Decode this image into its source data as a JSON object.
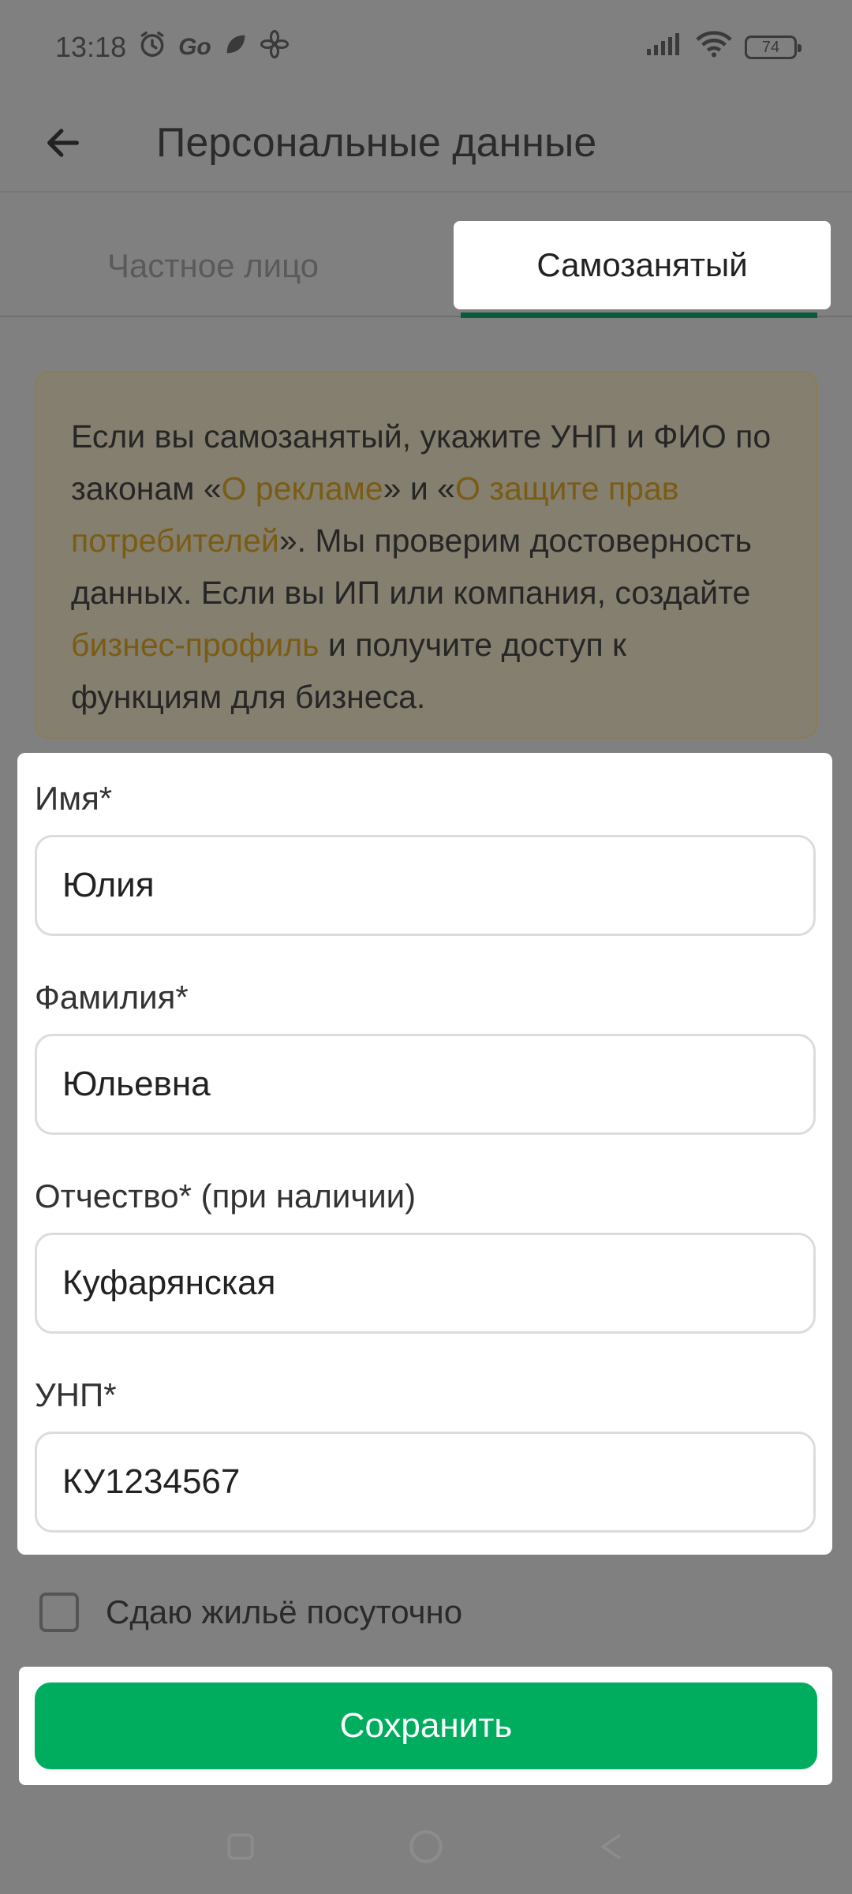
{
  "status_bar": {
    "time": "13:18",
    "battery": "74",
    "icons": [
      "alarm-icon",
      "go-icon",
      "app-notification-icon",
      "fan-icon",
      "signal-icon",
      "wifi-icon",
      "battery-icon"
    ]
  },
  "app_bar": {
    "back_icon": "arrow-left-icon",
    "title": "Персональные данные"
  },
  "tabs": [
    {
      "label": "Частное лицо",
      "selected": false
    },
    {
      "label": "Самозанятый",
      "selected": true
    }
  ],
  "info": {
    "t1": "Если вы самозанятый, укажите УНП и ФИО по законам «",
    "link1": "О рекламе",
    "t2": "» и «",
    "link2": "О защите прав потребителей",
    "t3": "». Мы проверим достоверность данных. Если вы ИП или компания, создайте ",
    "link3": "бизнес-профиль",
    "t4": " и получите доступ к функциям для бизнеса."
  },
  "form": {
    "name_label": "Имя*",
    "name_value": "Юлия",
    "surname_label": "Фамилия*",
    "surname_value": "Юльевна",
    "patronymic_label": "Отчество* (при наличии)",
    "patronymic_value": "Куфарянская",
    "unp_label": "УНП*",
    "unp_value": "КУ1234567"
  },
  "checkbox": {
    "label": "Сдаю жильё посуточно",
    "checked": false
  },
  "save_button": {
    "label": "Сохранить"
  },
  "colors": {
    "accent": "#00ad5e",
    "tab_indicator": "#0a5a3c",
    "link": "#7a5c14"
  }
}
